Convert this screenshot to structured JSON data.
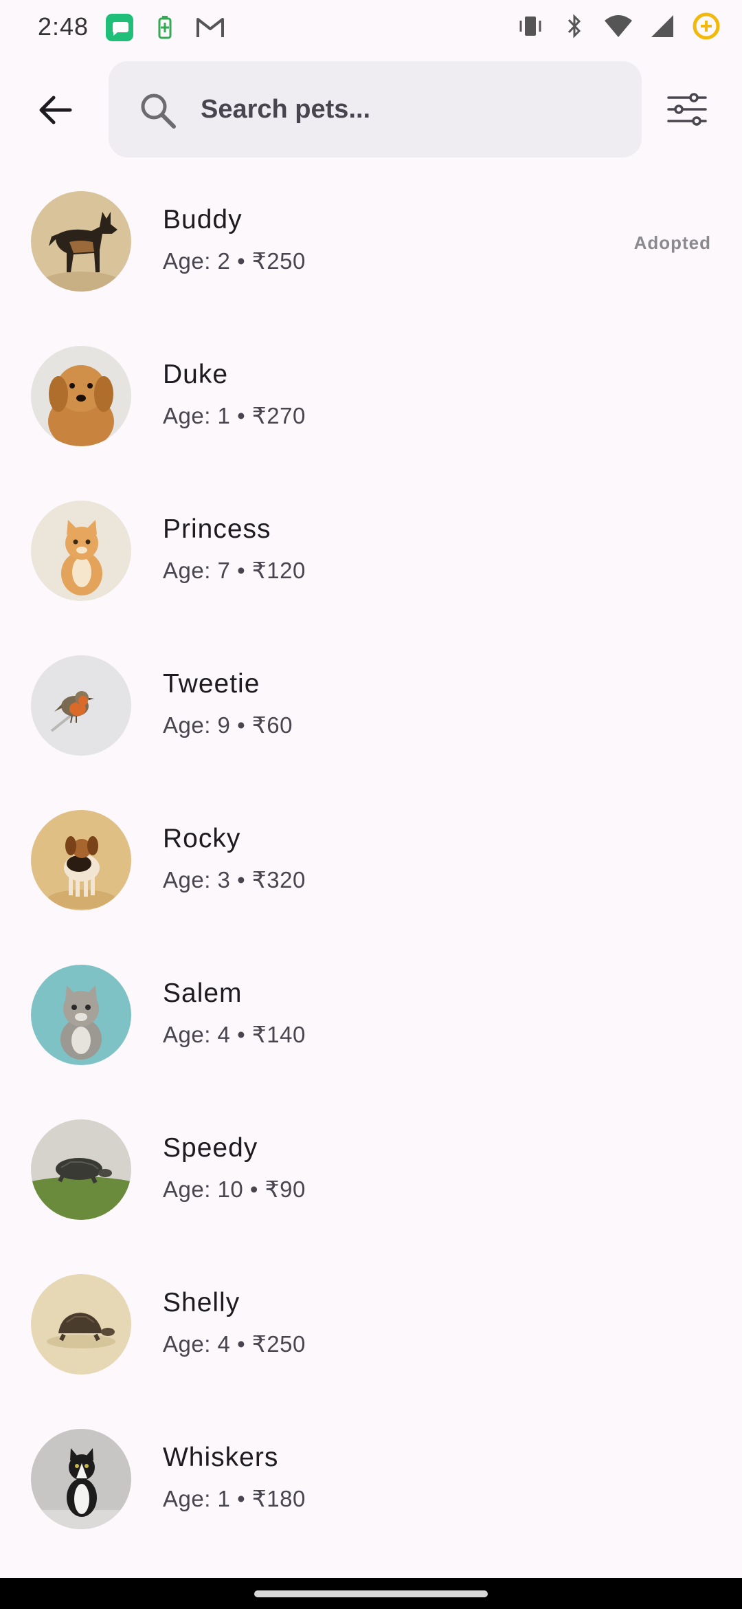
{
  "status_bar": {
    "time": "2:48",
    "icons_left": [
      "message-app-icon",
      "battery-saver-icon",
      "gmail-icon"
    ],
    "icons_right": [
      "vibrate-icon",
      "bluetooth-icon",
      "wifi-icon",
      "signal-icon",
      "data-saver-icon"
    ]
  },
  "search": {
    "placeholder": "Search pets...",
    "value": ""
  },
  "pets": [
    {
      "name": "Buddy",
      "details": "Age: 2 • ₹250",
      "status": "Adopted",
      "animal": "german-shepherd"
    },
    {
      "name": "Duke",
      "details": "Age: 1 • ₹270",
      "status": "",
      "animal": "golden-retriever"
    },
    {
      "name": "Princess",
      "details": "Age: 7 • ₹120",
      "status": "",
      "animal": "orange-kitten"
    },
    {
      "name": "Tweetie",
      "details": "Age: 9 • ₹60",
      "status": "",
      "animal": "robin"
    },
    {
      "name": "Rocky",
      "details": "Age: 3 • ₹320",
      "status": "",
      "animal": "beagle"
    },
    {
      "name": "Salem",
      "details": "Age: 4 • ₹140",
      "status": "",
      "animal": "gray-kitten"
    },
    {
      "name": "Speedy",
      "details": "Age: 10 • ₹90",
      "status": "",
      "animal": "turtle"
    },
    {
      "name": "Shelly",
      "details": "Age: 4 • ₹250",
      "status": "",
      "animal": "tortoise"
    },
    {
      "name": "Whiskers",
      "details": "Age: 1 • ₹180",
      "status": "",
      "animal": "tuxedo-cat"
    }
  ],
  "colors": {
    "background": "#fcf8fc",
    "search_bg": "#efedf1",
    "status_text": "#8a8a8e"
  }
}
